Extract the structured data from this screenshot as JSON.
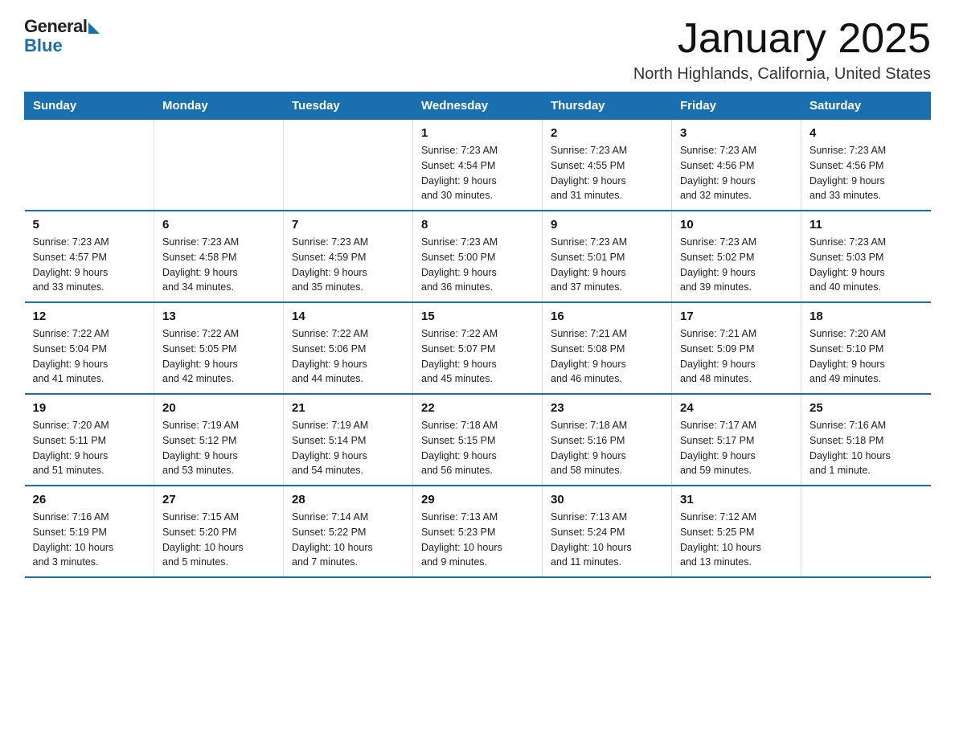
{
  "logo": {
    "general": "General",
    "blue": "Blue"
  },
  "title": "January 2025",
  "location": "North Highlands, California, United States",
  "weekdays": [
    "Sunday",
    "Monday",
    "Tuesday",
    "Wednesday",
    "Thursday",
    "Friday",
    "Saturday"
  ],
  "weeks": [
    [
      {
        "day": "",
        "info": ""
      },
      {
        "day": "",
        "info": ""
      },
      {
        "day": "",
        "info": ""
      },
      {
        "day": "1",
        "info": "Sunrise: 7:23 AM\nSunset: 4:54 PM\nDaylight: 9 hours\nand 30 minutes."
      },
      {
        "day": "2",
        "info": "Sunrise: 7:23 AM\nSunset: 4:55 PM\nDaylight: 9 hours\nand 31 minutes."
      },
      {
        "day": "3",
        "info": "Sunrise: 7:23 AM\nSunset: 4:56 PM\nDaylight: 9 hours\nand 32 minutes."
      },
      {
        "day": "4",
        "info": "Sunrise: 7:23 AM\nSunset: 4:56 PM\nDaylight: 9 hours\nand 33 minutes."
      }
    ],
    [
      {
        "day": "5",
        "info": "Sunrise: 7:23 AM\nSunset: 4:57 PM\nDaylight: 9 hours\nand 33 minutes."
      },
      {
        "day": "6",
        "info": "Sunrise: 7:23 AM\nSunset: 4:58 PM\nDaylight: 9 hours\nand 34 minutes."
      },
      {
        "day": "7",
        "info": "Sunrise: 7:23 AM\nSunset: 4:59 PM\nDaylight: 9 hours\nand 35 minutes."
      },
      {
        "day": "8",
        "info": "Sunrise: 7:23 AM\nSunset: 5:00 PM\nDaylight: 9 hours\nand 36 minutes."
      },
      {
        "day": "9",
        "info": "Sunrise: 7:23 AM\nSunset: 5:01 PM\nDaylight: 9 hours\nand 37 minutes."
      },
      {
        "day": "10",
        "info": "Sunrise: 7:23 AM\nSunset: 5:02 PM\nDaylight: 9 hours\nand 39 minutes."
      },
      {
        "day": "11",
        "info": "Sunrise: 7:23 AM\nSunset: 5:03 PM\nDaylight: 9 hours\nand 40 minutes."
      }
    ],
    [
      {
        "day": "12",
        "info": "Sunrise: 7:22 AM\nSunset: 5:04 PM\nDaylight: 9 hours\nand 41 minutes."
      },
      {
        "day": "13",
        "info": "Sunrise: 7:22 AM\nSunset: 5:05 PM\nDaylight: 9 hours\nand 42 minutes."
      },
      {
        "day": "14",
        "info": "Sunrise: 7:22 AM\nSunset: 5:06 PM\nDaylight: 9 hours\nand 44 minutes."
      },
      {
        "day": "15",
        "info": "Sunrise: 7:22 AM\nSunset: 5:07 PM\nDaylight: 9 hours\nand 45 minutes."
      },
      {
        "day": "16",
        "info": "Sunrise: 7:21 AM\nSunset: 5:08 PM\nDaylight: 9 hours\nand 46 minutes."
      },
      {
        "day": "17",
        "info": "Sunrise: 7:21 AM\nSunset: 5:09 PM\nDaylight: 9 hours\nand 48 minutes."
      },
      {
        "day": "18",
        "info": "Sunrise: 7:20 AM\nSunset: 5:10 PM\nDaylight: 9 hours\nand 49 minutes."
      }
    ],
    [
      {
        "day": "19",
        "info": "Sunrise: 7:20 AM\nSunset: 5:11 PM\nDaylight: 9 hours\nand 51 minutes."
      },
      {
        "day": "20",
        "info": "Sunrise: 7:19 AM\nSunset: 5:12 PM\nDaylight: 9 hours\nand 53 minutes."
      },
      {
        "day": "21",
        "info": "Sunrise: 7:19 AM\nSunset: 5:14 PM\nDaylight: 9 hours\nand 54 minutes."
      },
      {
        "day": "22",
        "info": "Sunrise: 7:18 AM\nSunset: 5:15 PM\nDaylight: 9 hours\nand 56 minutes."
      },
      {
        "day": "23",
        "info": "Sunrise: 7:18 AM\nSunset: 5:16 PM\nDaylight: 9 hours\nand 58 minutes."
      },
      {
        "day": "24",
        "info": "Sunrise: 7:17 AM\nSunset: 5:17 PM\nDaylight: 9 hours\nand 59 minutes."
      },
      {
        "day": "25",
        "info": "Sunrise: 7:16 AM\nSunset: 5:18 PM\nDaylight: 10 hours\nand 1 minute."
      }
    ],
    [
      {
        "day": "26",
        "info": "Sunrise: 7:16 AM\nSunset: 5:19 PM\nDaylight: 10 hours\nand 3 minutes."
      },
      {
        "day": "27",
        "info": "Sunrise: 7:15 AM\nSunset: 5:20 PM\nDaylight: 10 hours\nand 5 minutes."
      },
      {
        "day": "28",
        "info": "Sunrise: 7:14 AM\nSunset: 5:22 PM\nDaylight: 10 hours\nand 7 minutes."
      },
      {
        "day": "29",
        "info": "Sunrise: 7:13 AM\nSunset: 5:23 PM\nDaylight: 10 hours\nand 9 minutes."
      },
      {
        "day": "30",
        "info": "Sunrise: 7:13 AM\nSunset: 5:24 PM\nDaylight: 10 hours\nand 11 minutes."
      },
      {
        "day": "31",
        "info": "Sunrise: 7:12 AM\nSunset: 5:25 PM\nDaylight: 10 hours\nand 13 minutes."
      },
      {
        "day": "",
        "info": ""
      }
    ]
  ]
}
